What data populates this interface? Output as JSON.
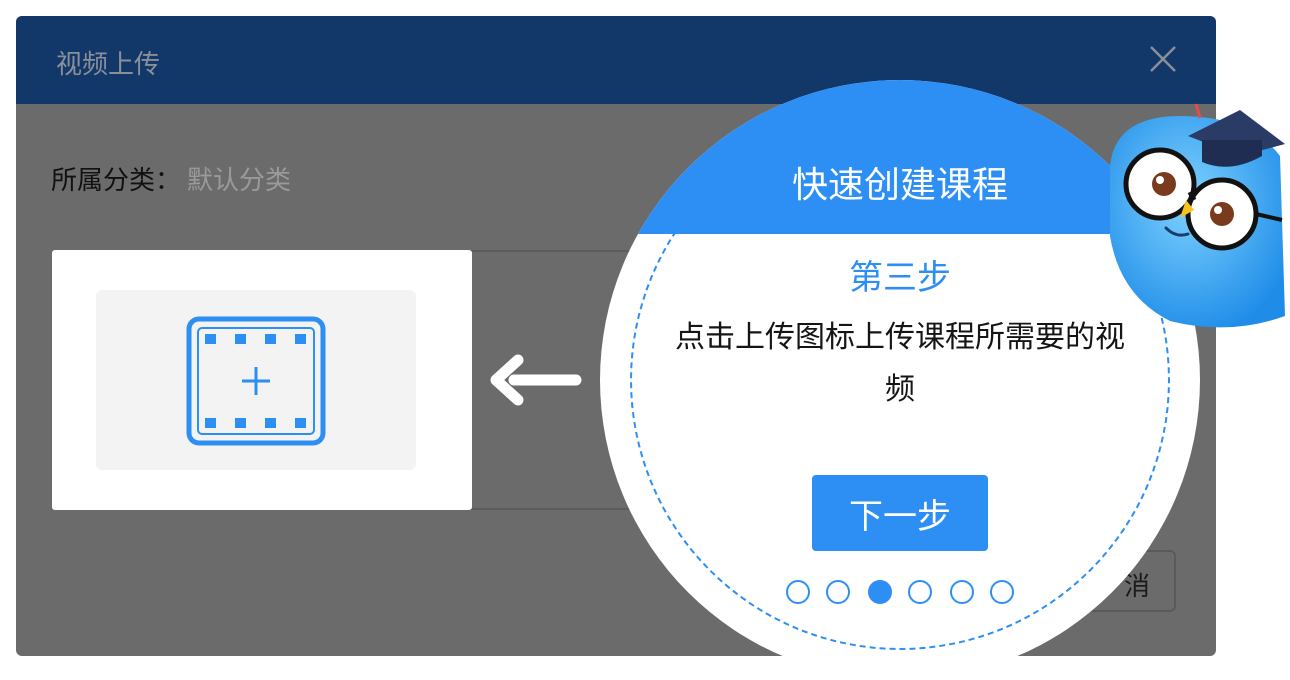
{
  "dialog": {
    "title": "视频上传",
    "category_label": "所属分类：",
    "category_value": "默认分类",
    "cancel_label": "消"
  },
  "tour": {
    "title": "快速创建课程",
    "step_title": "第三步",
    "step_description": "点击上传图标上传课程所需要的视频",
    "next_label": "下一步",
    "total_steps": 6,
    "current_step": 3
  },
  "colors": {
    "header": "#12386a",
    "overlay": "#6b6b6b",
    "accent": "#2d8ff3"
  },
  "icons": {
    "close": "close-icon",
    "upload": "film-plus-icon",
    "arrow": "arrow-left-icon"
  }
}
